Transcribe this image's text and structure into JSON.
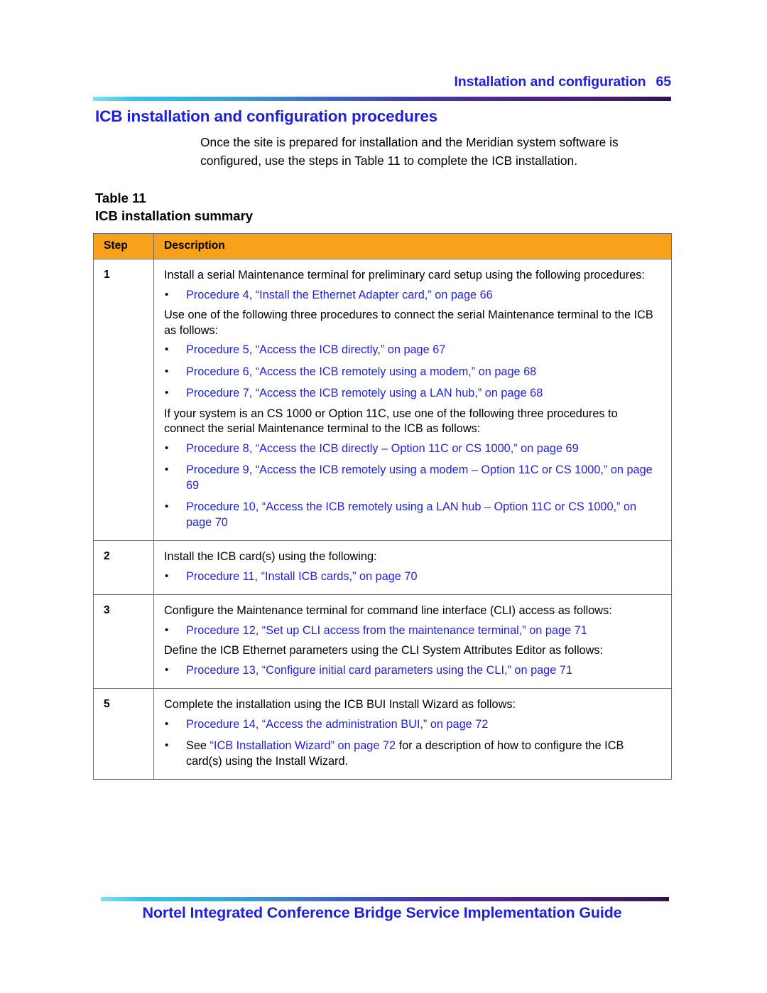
{
  "header": {
    "section_title": "Installation and configuration",
    "page_number": "65"
  },
  "section": {
    "heading": "ICB installation and configuration procedures",
    "intro": "Once the site is prepared for installation and the Meridian system software is configured, use the steps in Table 11 to complete the ICB installation."
  },
  "table_caption": {
    "label": "Table 11",
    "title": "ICB installation summary"
  },
  "table": {
    "columns": [
      "Step",
      "Description"
    ],
    "rows": [
      {
        "step": "1",
        "blocks": [
          {
            "type": "para",
            "text": "Install a serial Maintenance terminal for preliminary card setup using the following procedures:"
          },
          {
            "type": "bullets",
            "items": [
              {
                "link": "Procedure 4,  “Install the Ethernet Adapter card,” on page 66"
              }
            ]
          },
          {
            "type": "para",
            "text": "Use one of the following three procedures to connect the serial Maintenance terminal to the ICB as follows:"
          },
          {
            "type": "bullets",
            "items": [
              {
                "link": "Procedure 5,  “Access the ICB directly,” on page 67"
              },
              {
                "link": "Procedure 6,  “Access the ICB remotely using a modem,” on page 68"
              },
              {
                "link": "Procedure 7,  “Access the ICB remotely using a LAN hub,” on page 68"
              }
            ]
          },
          {
            "type": "para",
            "text": "If your system is an CS 1000 or Option 11C, use one of the following three procedures to connect the serial Maintenance terminal to the ICB as follows:"
          },
          {
            "type": "bullets",
            "items": [
              {
                "link": "Procedure 8,  “Access the ICB directly – Option 11C or CS 1000,” on page 69"
              },
              {
                "link": "Procedure 9,  “Access the ICB remotely using a modem – Option 11C or CS 1000,” on page 69"
              },
              {
                "link": "Procedure 10,  “Access the ICB remotely using a LAN hub – Option 11C or CS 1000,” on page 70"
              }
            ]
          }
        ]
      },
      {
        "step": "2",
        "blocks": [
          {
            "type": "para",
            "text": "Install the ICB card(s) using the following:"
          },
          {
            "type": "bullets",
            "items": [
              {
                "link": "Procedure 11,  “Install ICB cards,” on page 70"
              }
            ]
          }
        ]
      },
      {
        "step": "3",
        "blocks": [
          {
            "type": "para",
            "text": "Configure the Maintenance terminal for command line interface (CLI) access as follows:"
          },
          {
            "type": "bullets",
            "items": [
              {
                "link": "Procedure 12,  “Set up CLI access from the maintenance terminal,” on page 71"
              }
            ]
          },
          {
            "type": "para",
            "text": "Define the ICB Ethernet parameters using the CLI System Attributes Editor as follows:"
          },
          {
            "type": "bullets",
            "items": [
              {
                "link": "Procedure 13,  “Configure initial card parameters using the CLI,” on page 71"
              }
            ]
          }
        ]
      },
      {
        "step": "5",
        "blocks": [
          {
            "type": "para",
            "text": "Complete the installation using the ICB BUI Install Wizard as follows:"
          },
          {
            "type": "bullets",
            "items": [
              {
                "link": "Procedure 14,  “Access the administration BUI,” on page 72"
              },
              {
                "prefix": "See ",
                "link": "“ICB Installation Wizard” on page 72",
                "suffix": " for a description of how to configure the ICB card(s) using the Install Wizard."
              }
            ]
          }
        ]
      }
    ]
  },
  "footer": {
    "title": "Nortel Integrated Conference Bridge Service Implementation Guide"
  },
  "colors": {
    "heading_blue": "#2020d8",
    "link_blue": "#2222dd",
    "table_header_orange": "#f9a01b",
    "table_border": "#6e6e6e"
  }
}
